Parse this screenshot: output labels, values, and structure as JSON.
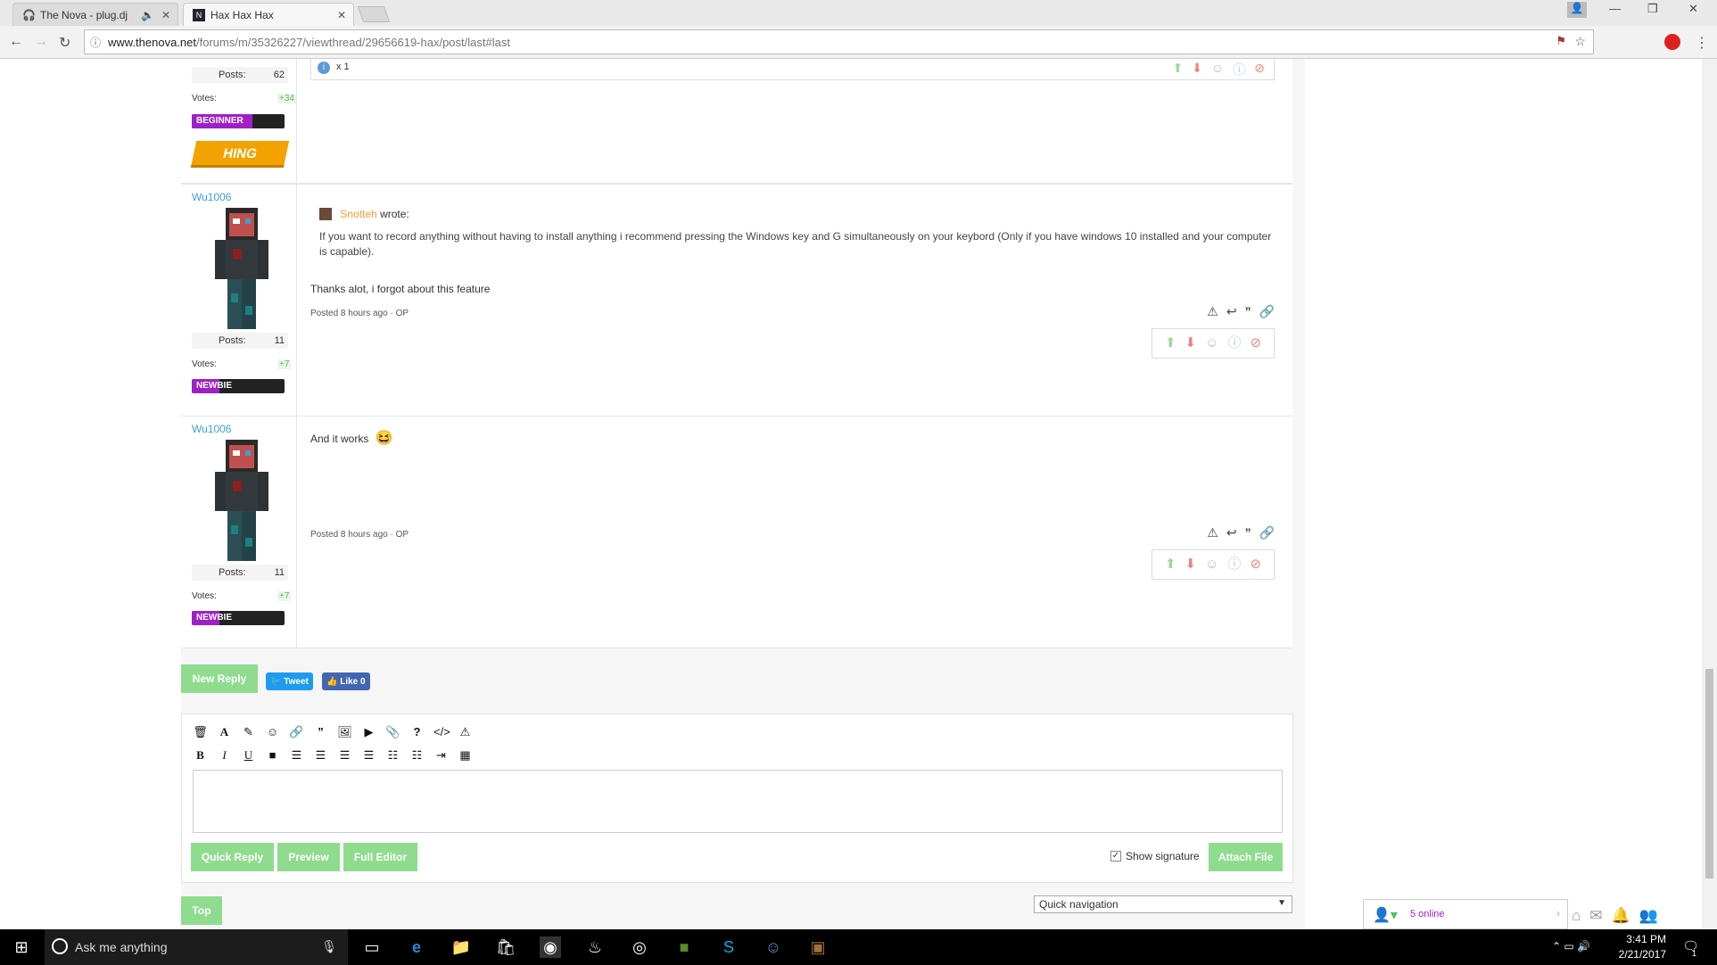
{
  "browser": {
    "tabs": [
      {
        "title": "The Nova - plug.dj"
      },
      {
        "title": "Hax Hax Hax"
      }
    ],
    "url_host": "www.thenova.net",
    "url_path": "/forums/m/35326227/viewthread/29656619-hax/post/last#last"
  },
  "top_post": {
    "posts_label": "Posts:",
    "posts_value": "62",
    "votes_label": "Votes:",
    "votes_value": "+34",
    "rank": "BEGINNER",
    "badge": "HING",
    "info_count": "x 1"
  },
  "posts": [
    {
      "username": "Wu1006",
      "posts_label": "Posts:",
      "posts_value": "11",
      "votes_label": "Votes:",
      "votes_value": "+7",
      "rank": "NEWBIE",
      "quote_author": "Snotteh",
      "quote_wrote": "wrote:",
      "quote_text": "If you want to record anything without having to install anything i recommend pressing the Windows key and G simultaneously on your keybord (Only if you have windows 10 installed and your computer is capable).",
      "message": "Thanks alot, i forgot about this feature",
      "posted": "Posted 8 hours ago · OP"
    },
    {
      "username": "Wu1006",
      "posts_label": "Posts:",
      "posts_value": "11",
      "votes_label": "Votes:",
      "votes_value": "+7",
      "rank": "NEWBIE",
      "message": "And it works",
      "emoji": "😆",
      "posted": "Posted 8 hours ago · OP"
    }
  ],
  "actions": {
    "new_reply": "New Reply",
    "tweet": "Tweet",
    "like": "Like 0",
    "quick_reply": "Quick Reply",
    "preview": "Preview",
    "full_editor": "Full Editor",
    "show_signature": "Show signature",
    "attach_file": "Attach File",
    "top": "Top",
    "quick_navigation": "Quick navigation",
    "online": "5 online"
  },
  "taskbar": {
    "search_placeholder": "Ask me anything",
    "time": "3:41 PM",
    "date": "2/21/2017",
    "notifications": "1"
  },
  "colors": {
    "accent_green": "#8fdc8f",
    "link_blue": "#3fa0d8",
    "rank_purple": "#a020c8",
    "badge_orange": "#f2a300"
  }
}
